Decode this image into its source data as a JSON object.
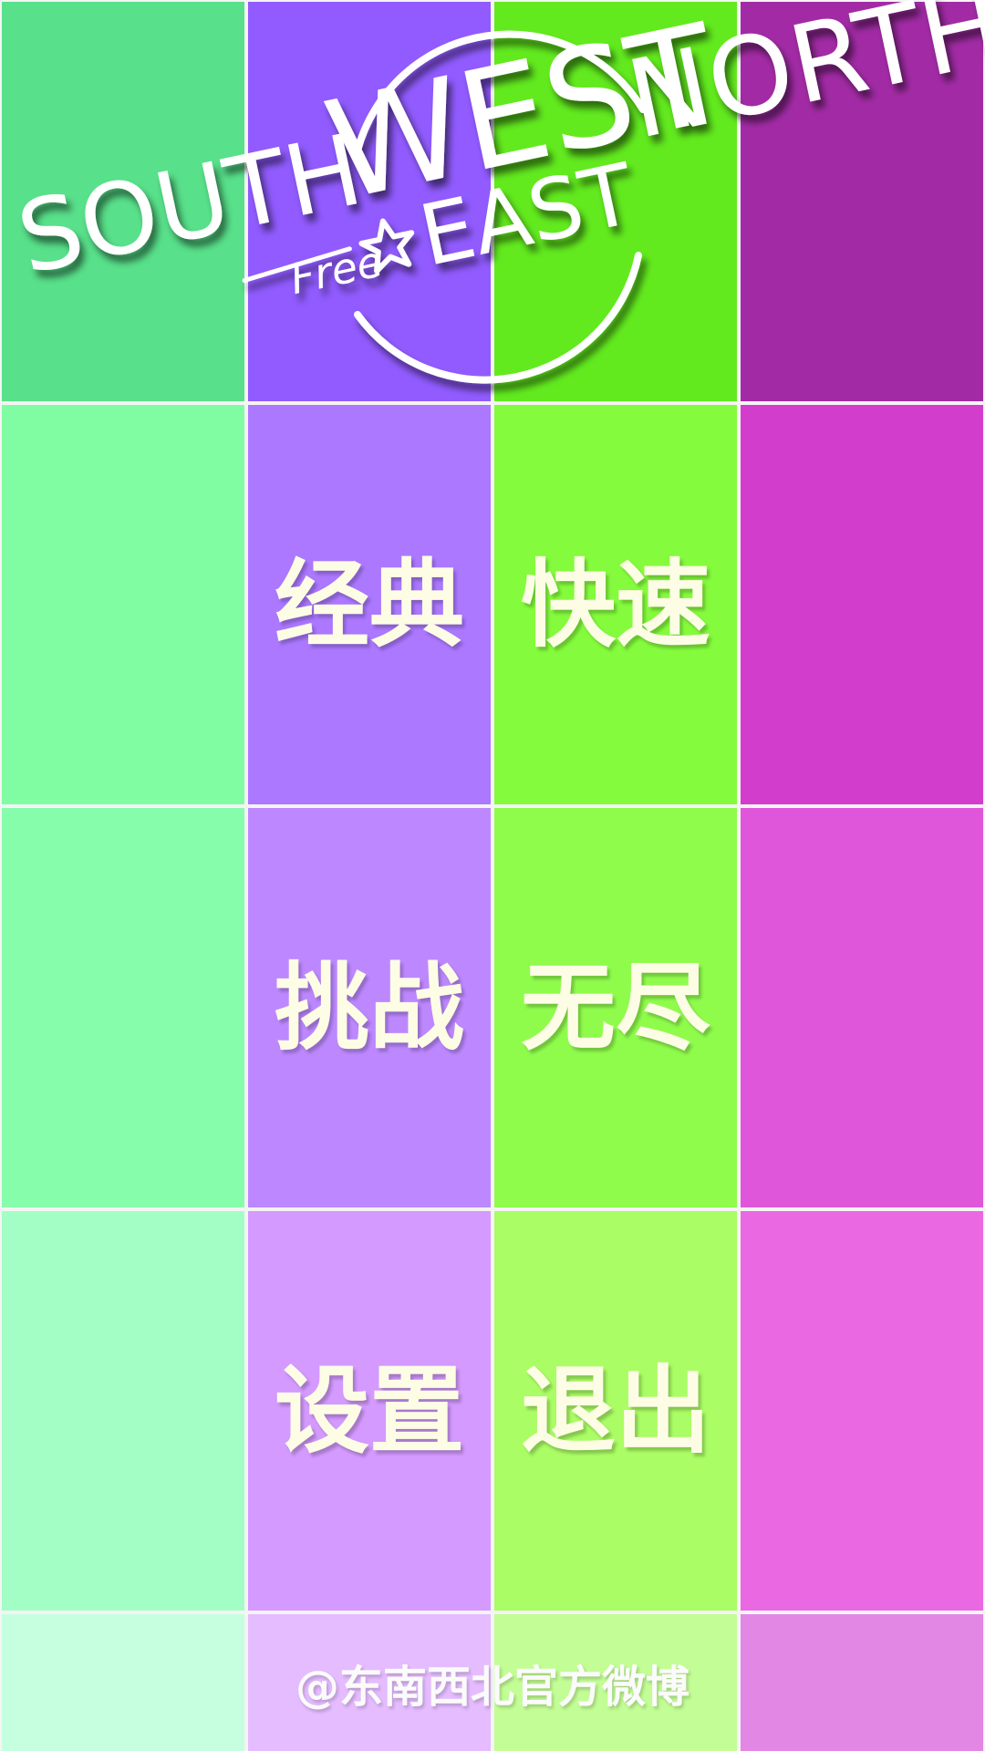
{
  "logo": {
    "word_south": "SOUTH",
    "word_west": "WEST",
    "word_north": "NORTH",
    "word_east": "EAST",
    "word_free": "Free",
    "star_icon": "star-outline-icon"
  },
  "menu": {
    "classic": "经典",
    "fast": "快速",
    "challenge": "挑战",
    "endless": "无尽",
    "settings": "设置",
    "exit": "退出"
  },
  "footer": {
    "weibo": "@东南西北官方微博"
  },
  "colors": {
    "col0": [
      "#58e08a",
      "#80fda2",
      "#86fdab",
      "#a2fec4",
      "#c6ffdf"
    ],
    "col1": [
      "#915bff",
      "#ab78ff",
      "#bd88ff",
      "#d49aff",
      "#e5bcff"
    ],
    "col2": [
      "#62ea1e",
      "#84fb3c",
      "#8ffc4c",
      "#aafd64",
      "#c3fd95"
    ],
    "col3": [
      "#a22ba5",
      "#d33dcc",
      "#e056da",
      "#ea68e1",
      "#e287e3"
    ],
    "label": "#fdfde6",
    "gap": "#f4f4f4"
  }
}
